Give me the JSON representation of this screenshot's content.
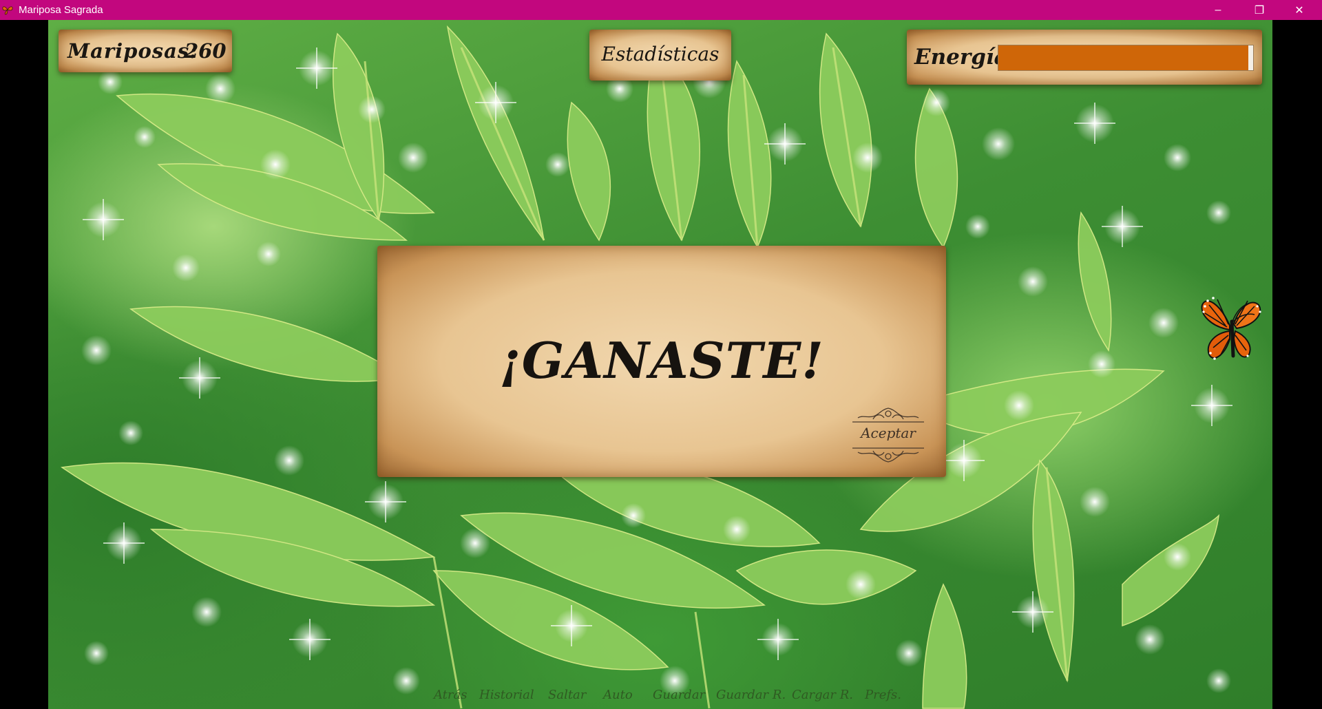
{
  "window": {
    "title": "Mariposa Sagrada",
    "controls": {
      "minimize": "–",
      "maximize": "❐",
      "close": "✕"
    }
  },
  "hud": {
    "butterflies_label": "Mariposas:",
    "butterflies_value": "260",
    "stats_label": "Estadísticas",
    "energy_label": "Energía",
    "energy_level": 0.98,
    "energy_color": "#cf6608"
  },
  "dialog": {
    "message": "¡GANASTE!",
    "accept_label": "Aceptar"
  },
  "quick_menu": {
    "items": [
      "Atrás",
      "Historial",
      "Saltar",
      "Auto",
      "Guardar",
      "Guardar R.",
      "Cargar R.",
      "Prefs."
    ]
  },
  "colors": {
    "titlebar": "#c2077e",
    "parchment": "#e8c592",
    "butterfly_orange": "#e8640c"
  },
  "icons": {
    "app_icon": "butterfly-icon",
    "character": "monarch-butterfly"
  }
}
